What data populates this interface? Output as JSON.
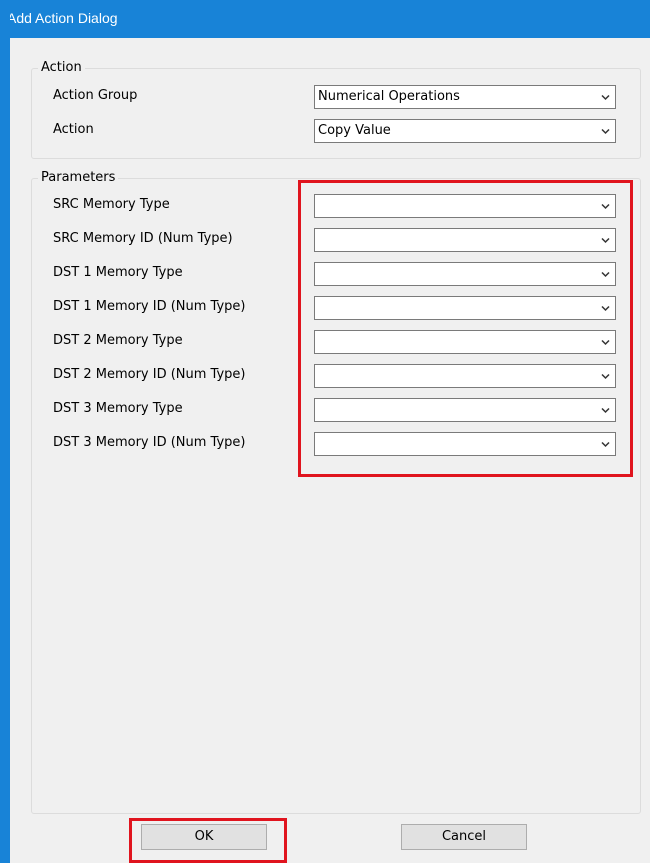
{
  "window": {
    "title": "Add Action Dialog",
    "accent_color": "#1883d7",
    "highlight_color": "#e0141e"
  },
  "action_group": {
    "legend": "Action",
    "fields": [
      {
        "label": "Action Group",
        "value": "Numerical Operations",
        "icon": "chevron-down-icon"
      },
      {
        "label": "Action",
        "value": "Copy Value",
        "icon": "chevron-down-icon"
      }
    ]
  },
  "parameters_group": {
    "legend": "Parameters",
    "fields": [
      {
        "label": "SRC Memory Type",
        "value": ""
      },
      {
        "label": "SRC Memory ID (Num Type)",
        "value": ""
      },
      {
        "label": "DST 1 Memory Type",
        "value": ""
      },
      {
        "label": "DST 1 Memory ID (Num Type)",
        "value": ""
      },
      {
        "label": "DST 2 Memory Type",
        "value": ""
      },
      {
        "label": "DST 2 Memory ID (Num Type)",
        "value": ""
      },
      {
        "label": "DST 3 Memory Type",
        "value": ""
      },
      {
        "label": "DST 3 Memory ID (Num Type)",
        "value": ""
      }
    ]
  },
  "buttons": {
    "ok_label": "OK",
    "cancel_label": "Cancel"
  }
}
